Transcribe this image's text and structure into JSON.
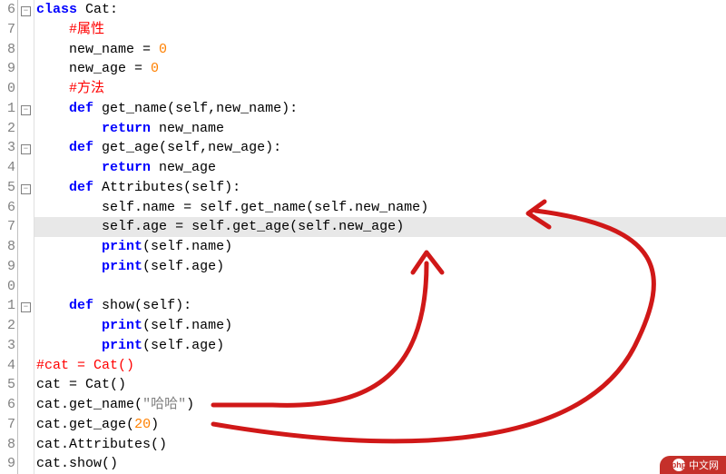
{
  "gutter_start": 6,
  "lines": [
    {
      "num": "6",
      "fold": "minus",
      "hl": false,
      "tokens": [
        [
          "kw",
          "class "
        ],
        [
          "cls",
          "Cat"
        ],
        [
          "op",
          ":"
        ]
      ]
    },
    {
      "num": "7",
      "fold": "",
      "hl": false,
      "tokens": [
        [
          "sp",
          "    "
        ],
        [
          "com",
          "#属性"
        ]
      ]
    },
    {
      "num": "8",
      "fold": "",
      "hl": false,
      "tokens": [
        [
          "sp",
          "    "
        ],
        [
          "id",
          "new_name "
        ],
        [
          "op",
          "= "
        ],
        [
          "num",
          "0"
        ]
      ]
    },
    {
      "num": "9",
      "fold": "",
      "hl": false,
      "tokens": [
        [
          "sp",
          "    "
        ],
        [
          "id",
          "new_age "
        ],
        [
          "op",
          "= "
        ],
        [
          "num",
          "0"
        ]
      ]
    },
    {
      "num": "0",
      "fold": "",
      "hl": false,
      "tokens": [
        [
          "sp",
          "    "
        ],
        [
          "com",
          "#方法"
        ]
      ]
    },
    {
      "num": "1",
      "fold": "minus",
      "hl": false,
      "tokens": [
        [
          "sp",
          "    "
        ],
        [
          "kw",
          "def "
        ],
        [
          "fn",
          "get_name"
        ],
        [
          "op",
          "("
        ],
        [
          "id",
          "self"
        ],
        [
          "op",
          ","
        ],
        [
          "id",
          "new_name"
        ],
        [
          "op",
          ")"
        ],
        [
          "op",
          ":"
        ]
      ]
    },
    {
      "num": "2",
      "fold": "",
      "hl": false,
      "tokens": [
        [
          "sp",
          "        "
        ],
        [
          "kw",
          "return "
        ],
        [
          "id",
          "new_name"
        ]
      ]
    },
    {
      "num": "3",
      "fold": "minus",
      "hl": false,
      "tokens": [
        [
          "sp",
          "    "
        ],
        [
          "kw",
          "def "
        ],
        [
          "fn",
          "get_age"
        ],
        [
          "op",
          "("
        ],
        [
          "id",
          "self"
        ],
        [
          "op",
          ","
        ],
        [
          "id",
          "new_age"
        ],
        [
          "op",
          ")"
        ],
        [
          "op",
          ":"
        ]
      ]
    },
    {
      "num": "4",
      "fold": "",
      "hl": false,
      "tokens": [
        [
          "sp",
          "        "
        ],
        [
          "kw",
          "return "
        ],
        [
          "id",
          "new_age"
        ]
      ]
    },
    {
      "num": "5",
      "fold": "minus",
      "hl": false,
      "tokens": [
        [
          "sp",
          "    "
        ],
        [
          "kw",
          "def "
        ],
        [
          "fn",
          "Attributes"
        ],
        [
          "op",
          "("
        ],
        [
          "id",
          "self"
        ],
        [
          "op",
          ")"
        ],
        [
          "op",
          ":"
        ]
      ]
    },
    {
      "num": "6",
      "fold": "",
      "hl": false,
      "tokens": [
        [
          "sp",
          "        "
        ],
        [
          "id",
          "self"
        ],
        [
          "op",
          "."
        ],
        [
          "id",
          "name "
        ],
        [
          "op",
          "= "
        ],
        [
          "id",
          "self"
        ],
        [
          "op",
          "."
        ],
        [
          "id",
          "get_name"
        ],
        [
          "op",
          "("
        ],
        [
          "id",
          "self"
        ],
        [
          "op",
          "."
        ],
        [
          "id",
          "new_name"
        ],
        [
          "op",
          ")"
        ]
      ]
    },
    {
      "num": "7",
      "fold": "",
      "hl": true,
      "tokens": [
        [
          "sp",
          "        "
        ],
        [
          "id",
          "self"
        ],
        [
          "op",
          "."
        ],
        [
          "id",
          "age "
        ],
        [
          "op",
          "= "
        ],
        [
          "id",
          "self"
        ],
        [
          "op",
          "."
        ],
        [
          "id",
          "get_age"
        ],
        [
          "op",
          "("
        ],
        [
          "id",
          "self"
        ],
        [
          "op",
          "."
        ],
        [
          "id",
          "new_age"
        ],
        [
          "op",
          ")"
        ]
      ]
    },
    {
      "num": "8",
      "fold": "",
      "hl": false,
      "tokens": [
        [
          "sp",
          "        "
        ],
        [
          "kw",
          "print"
        ],
        [
          "op",
          "("
        ],
        [
          "id",
          "self"
        ],
        [
          "op",
          "."
        ],
        [
          "id",
          "name"
        ],
        [
          "op",
          ")"
        ]
      ]
    },
    {
      "num": "9",
      "fold": "",
      "hl": false,
      "tokens": [
        [
          "sp",
          "        "
        ],
        [
          "kw",
          "print"
        ],
        [
          "op",
          "("
        ],
        [
          "id",
          "self"
        ],
        [
          "op",
          "."
        ],
        [
          "id",
          "age"
        ],
        [
          "op",
          ")"
        ]
      ]
    },
    {
      "num": "0",
      "fold": "",
      "hl": false,
      "tokens": []
    },
    {
      "num": "1",
      "fold": "minus",
      "hl": false,
      "tokens": [
        [
          "sp",
          "    "
        ],
        [
          "kw",
          "def "
        ],
        [
          "fn",
          "show"
        ],
        [
          "op",
          "("
        ],
        [
          "id",
          "self"
        ],
        [
          "op",
          ")"
        ],
        [
          "op",
          ":"
        ]
      ]
    },
    {
      "num": "2",
      "fold": "",
      "hl": false,
      "tokens": [
        [
          "sp",
          "        "
        ],
        [
          "kw",
          "print"
        ],
        [
          "op",
          "("
        ],
        [
          "id",
          "self"
        ],
        [
          "op",
          "."
        ],
        [
          "id",
          "name"
        ],
        [
          "op",
          ")"
        ]
      ]
    },
    {
      "num": "3",
      "fold": "",
      "hl": false,
      "tokens": [
        [
          "sp",
          "        "
        ],
        [
          "kw",
          "print"
        ],
        [
          "op",
          "("
        ],
        [
          "id",
          "self"
        ],
        [
          "op",
          "."
        ],
        [
          "id",
          "age"
        ],
        [
          "op",
          ")"
        ]
      ]
    },
    {
      "num": "4",
      "fold": "",
      "hl": false,
      "tokens": [
        [
          "com",
          "#cat = Cat()"
        ]
      ]
    },
    {
      "num": "5",
      "fold": "",
      "hl": false,
      "tokens": [
        [
          "id",
          "cat "
        ],
        [
          "op",
          "= "
        ],
        [
          "cls",
          "Cat"
        ],
        [
          "op",
          "()"
        ]
      ]
    },
    {
      "num": "6",
      "fold": "",
      "hl": false,
      "tokens": [
        [
          "id",
          "cat"
        ],
        [
          "op",
          "."
        ],
        [
          "id",
          "get_name"
        ],
        [
          "op",
          "("
        ],
        [
          "str",
          "\"哈哈\""
        ],
        [
          "op",
          ")"
        ]
      ]
    },
    {
      "num": "7",
      "fold": "",
      "hl": false,
      "tokens": [
        [
          "id",
          "cat"
        ],
        [
          "op",
          "."
        ],
        [
          "id",
          "get_age"
        ],
        [
          "op",
          "("
        ],
        [
          "num",
          "20"
        ],
        [
          "op",
          ")"
        ]
      ]
    },
    {
      "num": "8",
      "fold": "",
      "hl": false,
      "tokens": [
        [
          "id",
          "cat"
        ],
        [
          "op",
          "."
        ],
        [
          "id",
          "Attributes"
        ],
        [
          "op",
          "()"
        ]
      ]
    },
    {
      "num": "9",
      "fold": "",
      "hl": false,
      "tokens": [
        [
          "id",
          "cat"
        ],
        [
          "op",
          "."
        ],
        [
          "id",
          "show"
        ],
        [
          "op",
          "()"
        ]
      ]
    }
  ],
  "annotations": {
    "color": "#d01818",
    "stroke_width": 3,
    "arrows": [
      {
        "desc": "from cat.get_name(..) to line self.age=... inside Attributes",
        "from": "line20-end",
        "to": "line11-tail"
      },
      {
        "desc": "from cat.get_age(20) to line self.name=... inside Attributes",
        "from": "line21-end",
        "to": "line10-tail"
      }
    ]
  },
  "watermark": {
    "brand": "php",
    "text": "中文网"
  }
}
